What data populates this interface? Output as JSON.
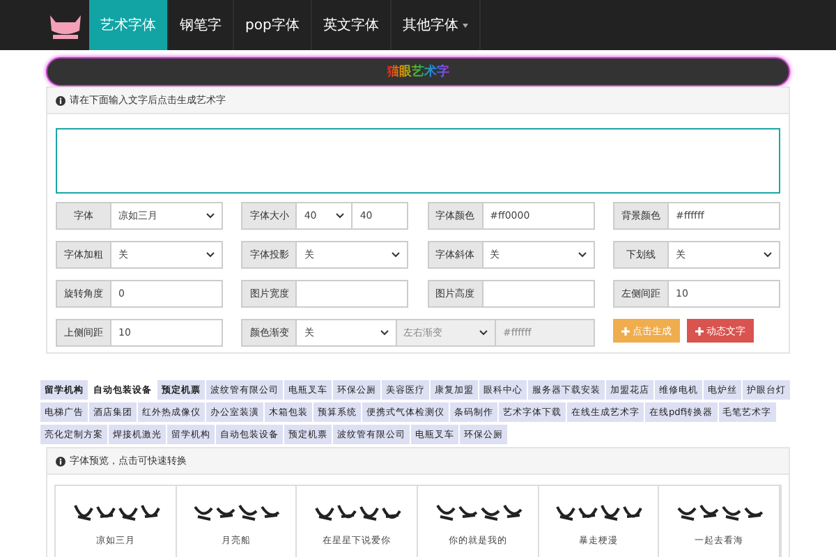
{
  "nav": {
    "tabs": [
      {
        "label": "艺术字体",
        "selected": true,
        "caret": false
      },
      {
        "label": "钢笔字",
        "selected": false,
        "caret": false
      },
      {
        "label": "pop字体",
        "selected": false,
        "caret": false
      },
      {
        "label": "英文字体",
        "selected": false,
        "caret": false
      },
      {
        "label": "其他字体",
        "selected": false,
        "caret": true
      }
    ]
  },
  "banner": {
    "title": "猫眼艺术字"
  },
  "input_panel": {
    "hint": "请在下面输入文字后点击生成艺术字"
  },
  "form": {
    "fields": [
      {
        "kind": "select",
        "label": "字体",
        "value": "凉如三月"
      },
      {
        "kind": "size",
        "label": "字体大小",
        "value": "40",
        "input": "40"
      },
      {
        "kind": "input",
        "label": "字体颜色",
        "value": "#ff0000"
      },
      {
        "kind": "input",
        "label": "背景颜色",
        "value": "#ffffff"
      },
      {
        "kind": "select",
        "label": "字体加粗",
        "value": "关"
      },
      {
        "kind": "select",
        "label": "字体投影",
        "value": "关"
      },
      {
        "kind": "select",
        "label": "字体斜体",
        "value": "关"
      },
      {
        "kind": "select",
        "label": "下划线",
        "value": "关"
      },
      {
        "kind": "input",
        "label": "旋转角度",
        "value": "0"
      },
      {
        "kind": "input",
        "label": "图片宽度"
      },
      {
        "kind": "input",
        "label": "图片高度"
      },
      {
        "kind": "input",
        "label": "左侧间距",
        "value": "10"
      },
      {
        "kind": "input",
        "label": "上侧间距",
        "value": "10"
      },
      {
        "kind": "gradient",
        "label": "颜色渐变",
        "value": "关",
        "direction": "左右渐变",
        "end_color": "#ffffff",
        "disabled": true
      },
      {
        "kind": "buttons",
        "buttons": [
          {
            "label": "点击生成",
            "kind": "generate"
          },
          {
            "label": "动态文字",
            "kind": "animate"
          }
        ]
      }
    ]
  },
  "tags": [
    {
      "label": "留学机构",
      "bold": true,
      "selected": false
    },
    {
      "label": "自动包装设备",
      "bold": true,
      "selected": true
    },
    {
      "label": "预定机票",
      "bold": true,
      "selected": false
    },
    {
      "label": "波纹管有限公司",
      "bold": false,
      "selected": false
    },
    {
      "label": "电瓶叉车",
      "bold": false,
      "selected": false
    },
    {
      "label": "环保公厕",
      "bold": false,
      "selected": false
    },
    {
      "label": "美容医疗",
      "bold": false,
      "selected": false
    },
    {
      "label": "康复加盟",
      "bold": false,
      "selected": false
    },
    {
      "label": "眼科中心",
      "bold": false,
      "selected": false
    },
    {
      "label": "服务器下载安装",
      "bold": false,
      "selected": false
    },
    {
      "label": "加盟花店",
      "bold": false,
      "selected": false
    },
    {
      "label": "维修电机",
      "bold": false,
      "selected": false
    },
    {
      "label": "电炉丝",
      "bold": false,
      "selected": false
    },
    {
      "label": "护眼台灯",
      "bold": false,
      "selected": false
    },
    {
      "label": "电梯广告",
      "bold": false,
      "selected": false
    },
    {
      "label": "酒店集团",
      "bold": false,
      "selected": false
    },
    {
      "label": "红外热成像仪",
      "bold": false,
      "selected": false
    },
    {
      "label": "办公室装潢",
      "bold": false,
      "selected": false
    },
    {
      "label": "木箱包装",
      "bold": false,
      "selected": false
    },
    {
      "label": "预算系统",
      "bold": false,
      "selected": false
    },
    {
      "label": "便携式气体检测仪",
      "bold": false,
      "selected": false
    },
    {
      "label": "条码制作",
      "bold": false,
      "selected": false
    },
    {
      "label": "艺术字体下载",
      "bold": false,
      "selected": false
    },
    {
      "label": "在线生成艺术字",
      "bold": false,
      "selected": false
    },
    {
      "label": "在线pdf转换器",
      "bold": false,
      "selected": false
    },
    {
      "label": "毛笔艺术字",
      "bold": false,
      "selected": false
    },
    {
      "label": "亮化定制方案",
      "bold": false,
      "selected": false
    },
    {
      "label": "焊接机激光",
      "bold": false,
      "selected": false
    },
    {
      "label": "留学机构",
      "bold": false,
      "selected": false
    },
    {
      "label": "自动包装设备",
      "bold": false,
      "selected": false
    },
    {
      "label": "预定机票",
      "bold": false,
      "selected": false
    },
    {
      "label": "波纹管有限公司",
      "bold": false,
      "selected": false
    },
    {
      "label": "电瓶叉车",
      "bold": false,
      "selected": false
    },
    {
      "label": "环保公厕",
      "bold": false,
      "selected": false
    }
  ],
  "preview_panel": {
    "hint": "字体预览，点击可快速转换",
    "fonts": [
      {
        "caption": "凉如三月"
      },
      {
        "caption": "月亮船"
      },
      {
        "caption": "在星星下说爱你"
      },
      {
        "caption": "你的就是我的"
      },
      {
        "caption": "暴走梗漫"
      },
      {
        "caption": "一起去看海"
      }
    ]
  }
}
